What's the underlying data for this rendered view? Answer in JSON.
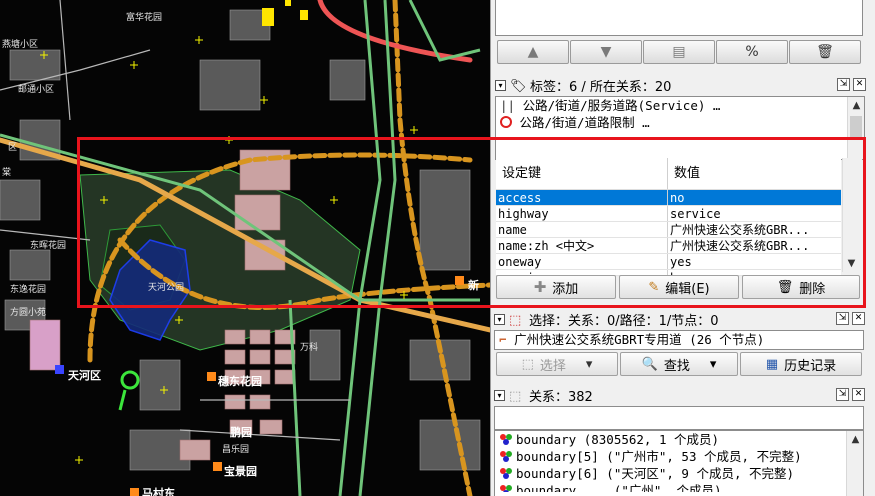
{
  "map": {
    "labels": {
      "l1": "富华花园",
      "l2": "燕塘小区",
      "l3": "邮通小区",
      "l4": "东晖花园",
      "l5": "东逸花园",
      "l6": "方圆小苑",
      "l7": "天河公园",
      "l8": "天河区",
      "l9": "穗东花园",
      "l10": "鹏园",
      "l11": "宝景园",
      "l12": "昌乐园",
      "l13": "新",
      "l14": "棠",
      "l15": "万科",
      "l16": "区",
      "l17": "马村东"
    }
  },
  "toolbar": {
    "icons": [
      "arrow-up-icon",
      "arrow-down-icon",
      "stack-icon",
      "percent-edit-icon",
      "trash-icon"
    ]
  },
  "tags_dialog": {
    "title": "标签：6 / 所在关系：20",
    "relations": [
      "公路/街道/服务道路(Service) …",
      "公路/街道/道路限制 …"
    ],
    "col_key": "设定键",
    "col_value": "数值",
    "rows": [
      {
        "key": "access",
        "value": "no"
      },
      {
        "key": "highway",
        "value": "service"
      },
      {
        "key": "name",
        "value": "广州快速公交系统GBR..."
      },
      {
        "key": "name:zh <中文>",
        "value": "广州快速公交系统GBR..."
      },
      {
        "key": "oneway",
        "value": "yes"
      },
      {
        "key": "service",
        "value": "bus"
      }
    ],
    "add_label": "添加",
    "edit_label": "编辑(E)",
    "delete_label": "删除"
  },
  "selection_dialog": {
    "title": "选择：关系：0/路径：1/节点：0",
    "item": "广州快速公交系统GBRT专用道 (26 个节点)",
    "select_label": "选择",
    "search_label": "查找",
    "history_label": "历史记录"
  },
  "relations_dialog": {
    "title": "关系：382",
    "items": [
      "boundary (8305562, 1 个成员)",
      "boundary[5] (\"广州市\", 53 个成员, 不完整)",
      "boundary[6] (\"天河区\", 9 个成员, 不完整)",
      "boundary ... (\"广州\", 个成员)"
    ]
  },
  "colors": {
    "highlight": "#e8141c",
    "selection": "#0078d7",
    "map_road": "#d89a2c",
    "map_park": "#233a23"
  }
}
